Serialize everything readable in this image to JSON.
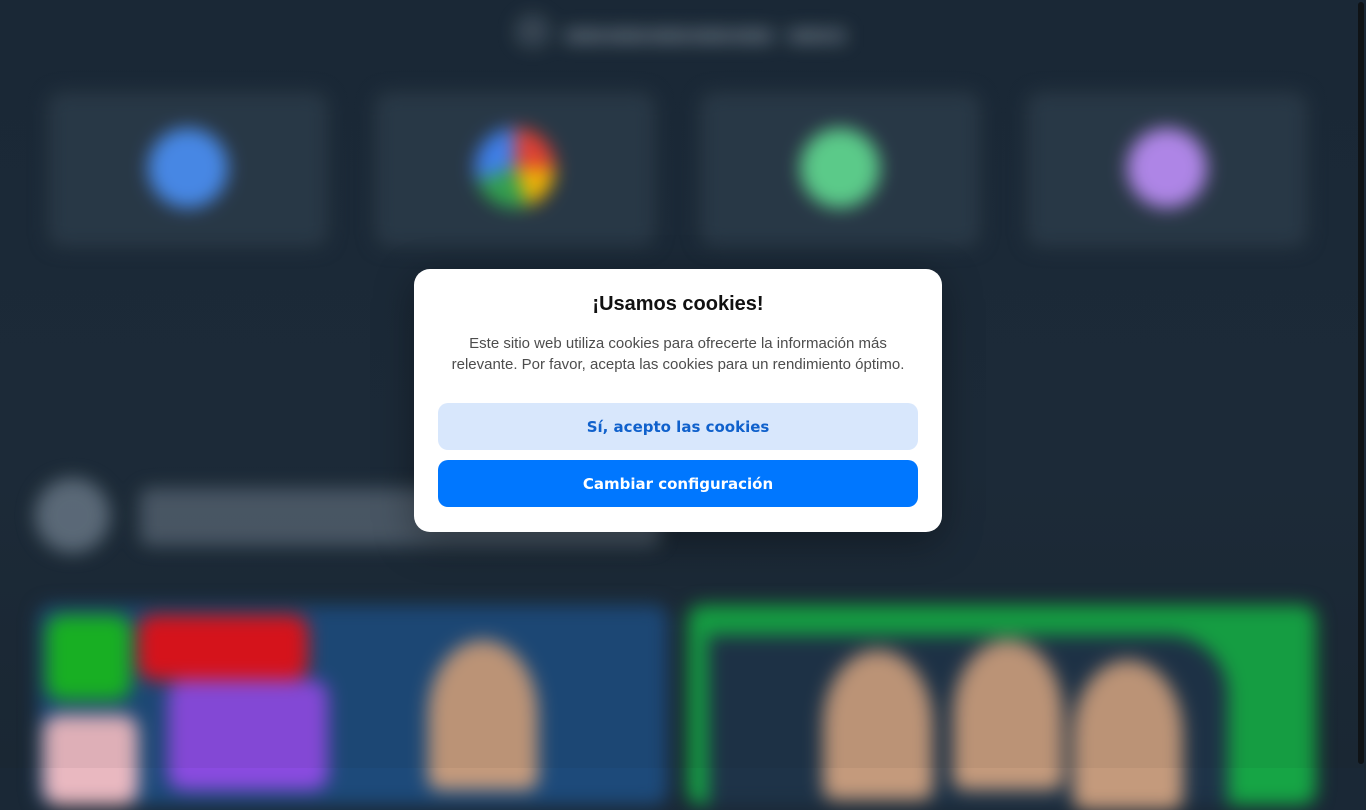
{
  "background": {
    "provider_logos": [
      "blue-circle-logo",
      "google-logo",
      "green-circle-logo",
      "purple-circle-logo"
    ],
    "colors": {
      "page_bg": "#1a2836",
      "card_bg": "#2a3a49",
      "promo_left": "#1d4a7a",
      "promo_right": "#16a545"
    }
  },
  "cookie_modal": {
    "title": "¡Usamos cookies!",
    "message": "Este sitio web utiliza cookies para ofrecerte la información más relevante. Por favor, acepta las cookies para un rendimiento óptimo.",
    "accept_label": "Sí, acepto las cookies",
    "settings_label": "Cambiar configuración",
    "colors": {
      "accept_bg": "#d8e7fc",
      "accept_text": "#1061cc",
      "settings_bg": "#0077ff",
      "settings_text": "#ffffff"
    }
  }
}
